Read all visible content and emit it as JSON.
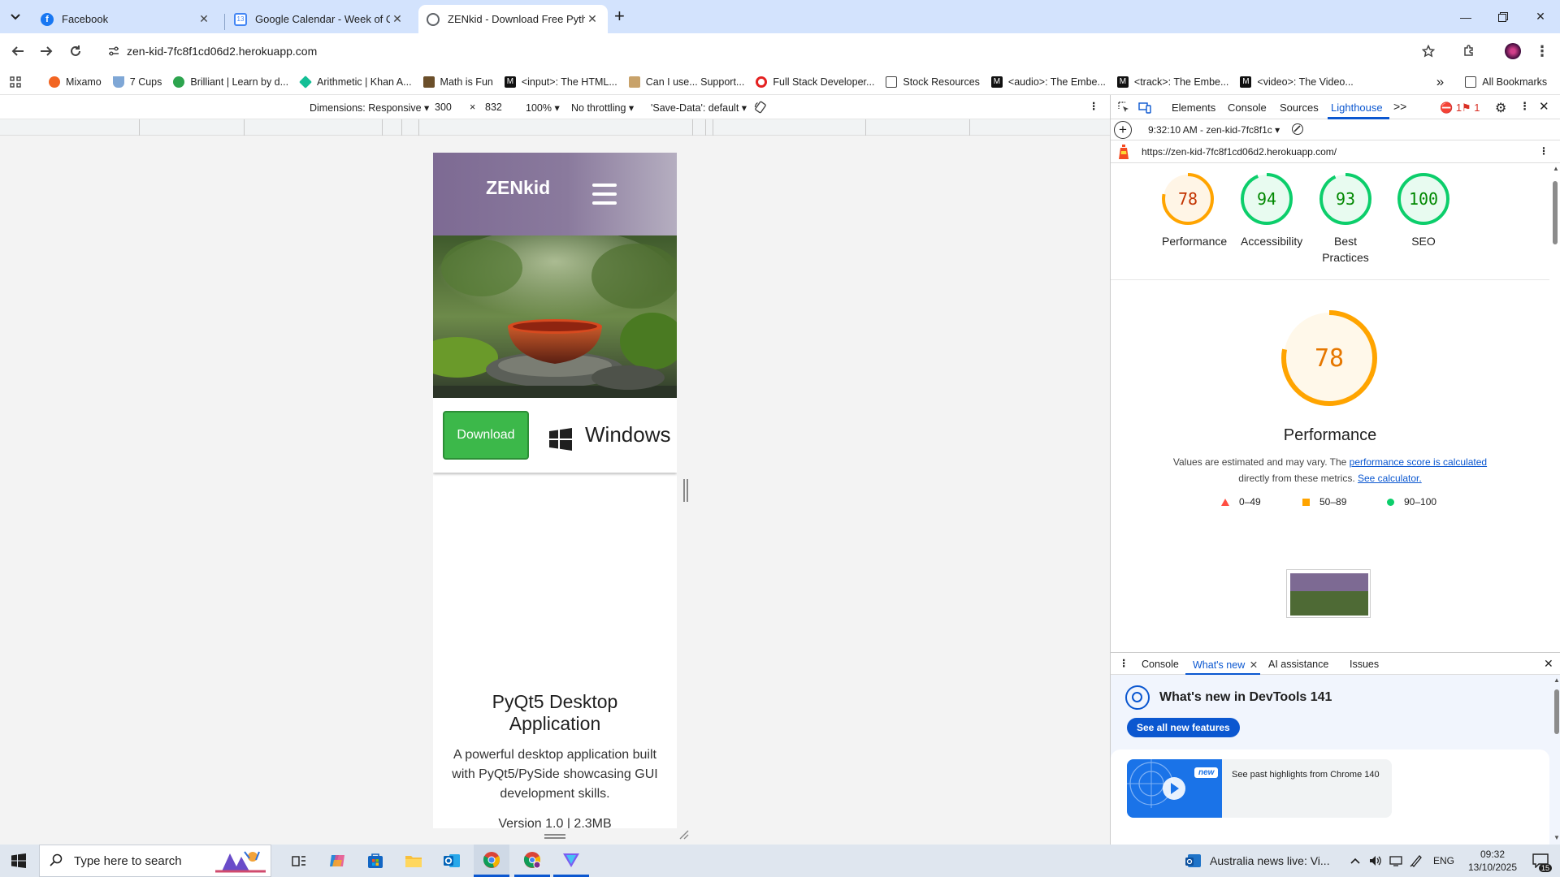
{
  "browser": {
    "tabs": [
      {
        "title": "Facebook",
        "active": false
      },
      {
        "title": "Google Calendar - Week of Oct",
        "active": false
      },
      {
        "title": "ZENkid - Download Free Pytho",
        "active": true
      }
    ],
    "new_tab_label": "+",
    "url": "zen-kid-7fc8f1cd06d2.herokuapp.com",
    "bookmarks": [
      "Mixamo",
      "7 Cups",
      "Brilliant | Learn by d...",
      "Arithmetic | Khan A...",
      "Math is Fun",
      "<input>: The HTML...",
      "Can I use... Support...",
      "Full Stack Developer...",
      "Stock Resources",
      "<audio>: The Embe...",
      "<track>: The Embe...",
      "<video>: The Video..."
    ],
    "all_bookmarks": "All Bookmarks",
    "overflow": "»"
  },
  "device_toolbar": {
    "dimensions": "Dimensions: Responsive",
    "width": "300",
    "times": "×",
    "height": "832",
    "zoom": "100%",
    "throttling": "No throttling",
    "save_data": "'Save-Data': default"
  },
  "emulated_page": {
    "logo": "ZENkid",
    "download_label": "Download",
    "platform": "Windows",
    "app_title": "PyQt5 Desktop Application",
    "app_description": "A powerful desktop application built with PyQt5/PySide showcasing GUI development skills.",
    "version": "Version 1.0 | 2.3MB"
  },
  "devtools": {
    "tabs": [
      "Elements",
      "Console",
      "Sources",
      "Lighthouse"
    ],
    "more_tabs": ">>",
    "errors": "1",
    "issues": "1",
    "report_selector": "9:32:10 AM - zen-kid-7fc8f1c",
    "report_url": "https://zen-kid-7fc8f1cd06d2.herokuapp.com/",
    "scores": [
      {
        "label": "Performance",
        "value": 78,
        "color": "#ffa400"
      },
      {
        "label": "Accessibility",
        "value": 94,
        "color": "#0cce6b"
      },
      {
        "label": "Best Practices",
        "value": 93,
        "color": "#0cce6b"
      },
      {
        "label": "SEO",
        "value": 100,
        "color": "#0cce6b"
      }
    ],
    "main_score": {
      "label": "Performance",
      "value": 78
    },
    "note_prefix": "Values are estimated and may vary. The ",
    "note_link1": "performance score is calculated",
    "note_middle": "directly from these metrics. ",
    "note_link2": "See calculator.",
    "legend": [
      {
        "range": "0–49",
        "color": "#ff4e42"
      },
      {
        "range": "50–89",
        "color": "#ffa400"
      },
      {
        "range": "90–100",
        "color": "#0cce6b"
      }
    ],
    "drawer_tabs": [
      "Console",
      "What's new",
      "AI assistance",
      "Issues"
    ],
    "whats_new_title": "What's new in DevTools 141",
    "see_all_button": "See all new features",
    "highlight_badge": "new",
    "highlight_text": "See past highlights from Chrome 140"
  },
  "taskbar": {
    "search_placeholder": "Type here to search",
    "news": "Australia news live: Vi...",
    "language": "ENG",
    "time": "09:32",
    "date": "13/10/2025",
    "notification_count": "15"
  },
  "colors": {
    "accent": "#0b57d0",
    "tabstrip": "#d3e3fd",
    "average": "#ffa400",
    "pass": "#0cce6b",
    "fail": "#ff4e42",
    "download_green": "#3cb84a"
  }
}
